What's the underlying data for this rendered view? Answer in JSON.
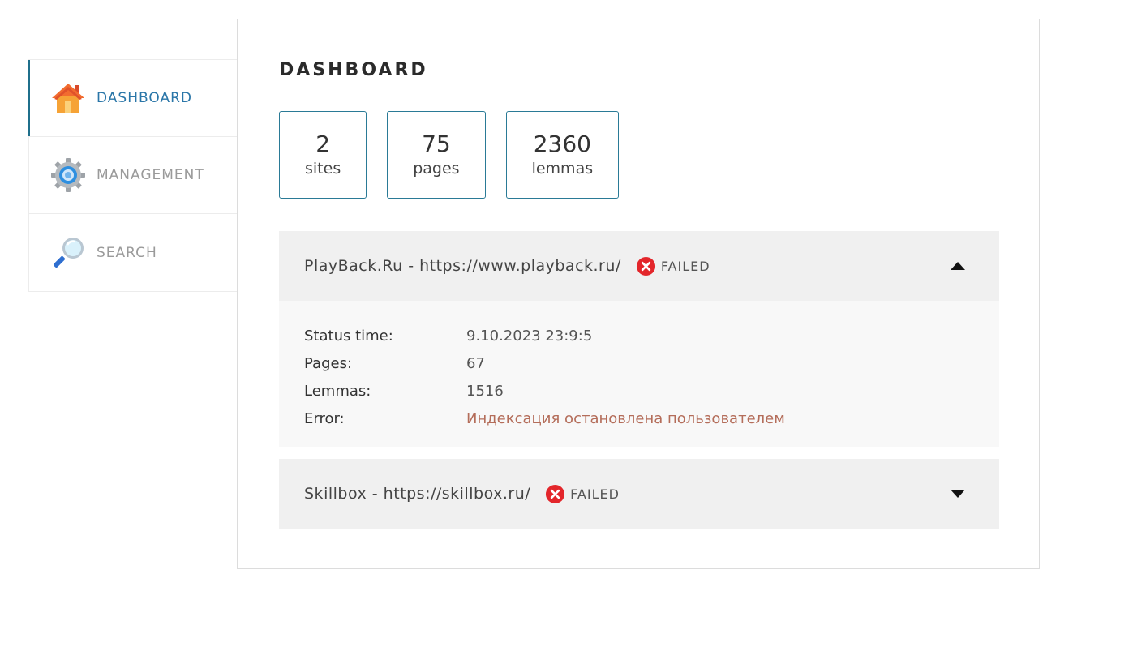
{
  "nav": {
    "items": [
      {
        "label": "DASHBOARD",
        "icon": "home-icon",
        "active": true
      },
      {
        "label": "MANAGEMENT",
        "icon": "gear-icon",
        "active": false
      },
      {
        "label": "SEARCH",
        "icon": "magnifier-icon",
        "active": false
      }
    ]
  },
  "dashboard": {
    "title": "DASHBOARD",
    "stats": [
      {
        "value": "2",
        "label": "sites"
      },
      {
        "value": "75",
        "label": "pages"
      },
      {
        "value": "2360",
        "label": "lemmas"
      }
    ],
    "sites": [
      {
        "name": "PlayBack.Ru - https://www.playback.ru/",
        "status": "FAILED",
        "expanded": true,
        "details": {
          "status_time_label": "Status time:",
          "status_time": "9.10.2023 23:9:5",
          "pages_label": "Pages:",
          "pages": "67",
          "lemmas_label": "Lemmas:",
          "lemmas": "1516",
          "error_label": "Error:",
          "error": "Индексация остановлена пользователем"
        }
      },
      {
        "name": "Skillbox - https://skillbox.ru/",
        "status": "FAILED",
        "expanded": false
      }
    ]
  },
  "colors": {
    "accent": "#2a76a8",
    "stat_border": "#2a7a96",
    "failed": "#e3262b",
    "error_text": "#b46d5a"
  }
}
